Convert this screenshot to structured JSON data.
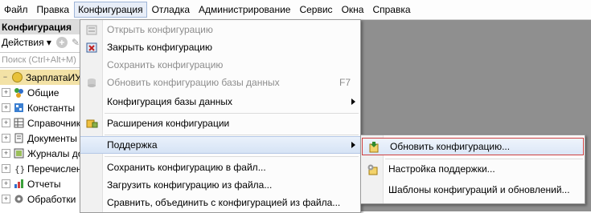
{
  "menubar": {
    "items": [
      "Файл",
      "Правка",
      "Конфигурация",
      "Отладка",
      "Администрирование",
      "Сервис",
      "Окна",
      "Справка"
    ],
    "active": "Конфигурация"
  },
  "panel": {
    "title": "Конфигурация",
    "actions_label": "Действия ▾",
    "search_placeholder": "Поиск (Ctrl+Alt+M)",
    "tree": [
      {
        "label": "ЗарплатаИУправ",
        "icon": "config-root-icon"
      },
      {
        "label": "Общие",
        "icon": "common-icon"
      },
      {
        "label": "Константы",
        "icon": "constants-icon"
      },
      {
        "label": "Справочники",
        "icon": "catalogs-icon"
      },
      {
        "label": "Документы",
        "icon": "documents-icon"
      },
      {
        "label": "Журналы до",
        "icon": "journals-icon"
      },
      {
        "label": "Перечислен",
        "icon": "enums-icon"
      },
      {
        "label": "Отчеты",
        "icon": "reports-icon"
      },
      {
        "label": "Обработки",
        "icon": "processing-icon"
      }
    ]
  },
  "dropdown": {
    "items": [
      {
        "label": "Открыть конфигурацию",
        "disabled": true,
        "icon": "open-config-icon"
      },
      {
        "label": "Закрыть конфигурацию",
        "disabled": false,
        "icon": "close-config-icon"
      },
      {
        "label": "Сохранить конфигурацию",
        "disabled": true,
        "icon": ""
      },
      {
        "label": "Обновить конфигурацию базы данных",
        "disabled": true,
        "icon": "update-db-icon",
        "shortcut": "F7"
      },
      {
        "label": "Конфигурация базы данных",
        "disabled": false,
        "icon": "",
        "submenu": true
      },
      {
        "label": "Расширения конфигурации",
        "disabled": false,
        "icon": "extensions-icon"
      },
      {
        "label": "Поддержка",
        "disabled": false,
        "icon": "",
        "submenu": true,
        "highlighted": true
      },
      {
        "label": "Сохранить конфигурацию в файл...",
        "disabled": false,
        "icon": ""
      },
      {
        "label": "Загрузить конфигурацию из файла...",
        "disabled": false,
        "icon": ""
      },
      {
        "label": "Сравнить, объединить с конфигурацией из файла...",
        "disabled": false,
        "icon": ""
      }
    ]
  },
  "submenu": {
    "items": [
      {
        "label": "Обновить конфигурацию...",
        "icon": "update-config-icon",
        "selected": true
      },
      {
        "label": "Настройка поддержки...",
        "icon": "support-settings-icon"
      },
      {
        "label": "Шаблоны конфигураций и обновлений...",
        "icon": ""
      }
    ]
  }
}
